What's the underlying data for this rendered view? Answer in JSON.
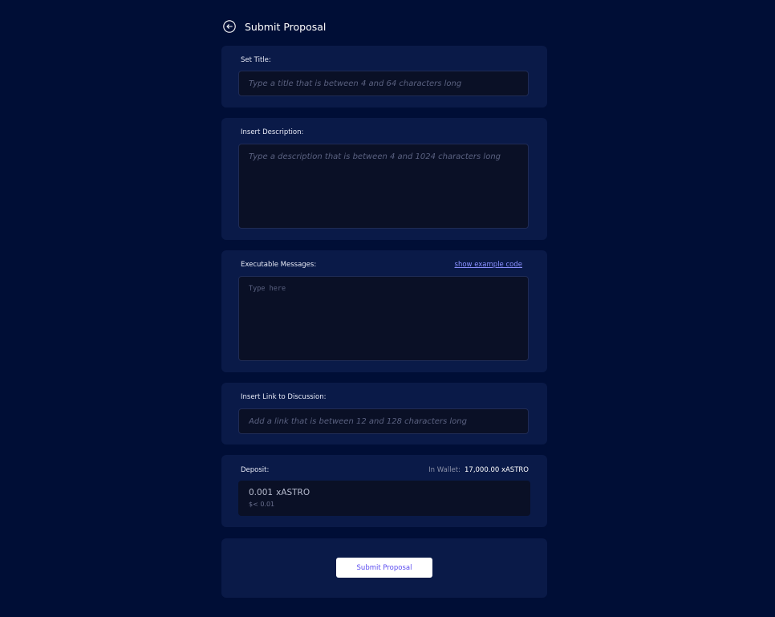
{
  "header": {
    "title": "Submit Proposal",
    "back_icon": "back-arrow-circle-icon"
  },
  "title_section": {
    "label": "Set Title:",
    "placeholder": "Type a title that is between 4 and 64 characters long",
    "value": ""
  },
  "description_section": {
    "label": "Insert Description:",
    "placeholder": "Type a description that is between 4 and 1024 characters long",
    "value": ""
  },
  "messages_section": {
    "label": "Executable Messages:",
    "example_link": "show example code",
    "placeholder": "Type here",
    "value": ""
  },
  "link_section": {
    "label": "Insert Link to Discussion:",
    "placeholder": "Add a link that is between 12 and 128 characters long",
    "value": ""
  },
  "deposit_section": {
    "label": "Deposit:",
    "wallet_label": "In Wallet:",
    "wallet_value": "17,000.00 xASTRO",
    "amount": "0.001",
    "token": "xASTRO",
    "usd_value": "$< 0.01"
  },
  "submit": {
    "label": "Submit Proposal"
  },
  "colors": {
    "background": "#000e36",
    "card": "#0a1a48",
    "input": "#0a1026",
    "link": "#8a90ff",
    "button_text": "#5b4cf0"
  }
}
